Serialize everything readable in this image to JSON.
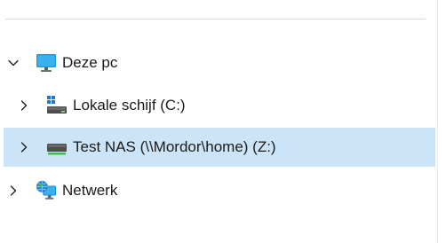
{
  "tree": {
    "items": [
      {
        "label": "Deze pc",
        "icon": "monitor-icon",
        "chevron": "expanded"
      },
      {
        "label": "Lokale schijf (C:)",
        "icon": "windows-drive-icon",
        "chevron": "collapsed"
      },
      {
        "label": "Test NAS (\\\\Mordor\\home) (Z:)",
        "icon": "network-drive-icon",
        "chevron": "collapsed",
        "selected": true
      },
      {
        "label": "Netwerk",
        "icon": "network-globe-icon",
        "chevron": "collapsed"
      }
    ]
  },
  "colors": {
    "selection": "#cce4f7",
    "text": "#1b1b1b"
  }
}
